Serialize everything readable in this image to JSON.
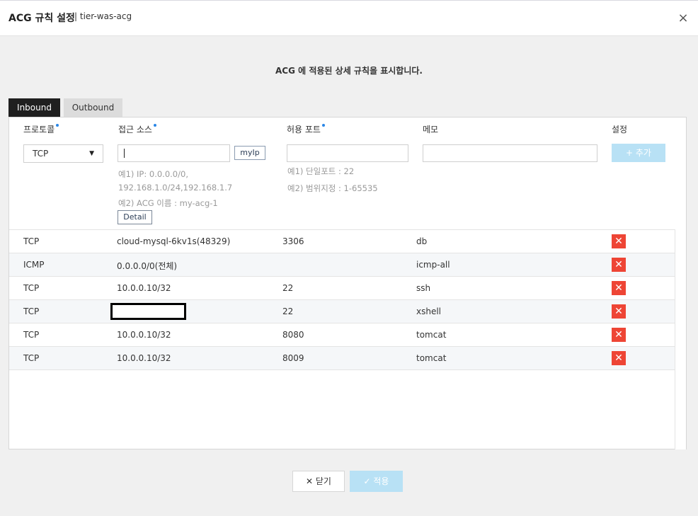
{
  "header": {
    "title": "ACG 규칙 설정",
    "subtitle": "| tier-was-acg",
    "close_icon": "×"
  },
  "description": "ACG 에 적용된 상세 규칙을 표시합니다.",
  "tabs": [
    {
      "label": "Inbound",
      "active": true
    },
    {
      "label": "Outbound",
      "active": false
    }
  ],
  "columns": {
    "protocol": "프로토콜",
    "source": "접근 소스",
    "port": "허용 포트",
    "memo": "메모",
    "settings": "설정"
  },
  "form": {
    "protocol_value": "TCP",
    "caret": "▼",
    "myip_label": "myIp",
    "add_label": "+ 추가",
    "detail_label": "Detail",
    "source_hint_1a": "예1) IP: 0.0.0.0/0,",
    "source_hint_1b": "192.168.1.0/24,192.168.1.7",
    "source_hint_2": "예2) ACG 이름 : my-acg-1",
    "port_hint_1": "예1) 단일포트 : 22",
    "port_hint_2": "예2) 범위지정 : 1-65535"
  },
  "rules": [
    {
      "protocol": "TCP",
      "source": "cloud-mysql-6kv1s(48329)",
      "port": "3306",
      "memo": "db",
      "redacted": false
    },
    {
      "protocol": "ICMP",
      "source": "0.0.0.0/0(전체)",
      "port": "",
      "memo": "icmp-all",
      "redacted": false
    },
    {
      "protocol": "TCP",
      "source": "10.0.0.10/32",
      "port": "22",
      "memo": "ssh",
      "redacted": false
    },
    {
      "protocol": "TCP",
      "source": "",
      "port": "22",
      "memo": "xshell",
      "redacted": true
    },
    {
      "protocol": "TCP",
      "source": "10.0.0.10/32",
      "port": "8080",
      "memo": "tomcat",
      "redacted": false
    },
    {
      "protocol": "TCP",
      "source": "10.0.0.10/32",
      "port": "8009",
      "memo": "tomcat",
      "redacted": false
    }
  ],
  "delete_icon": "✕",
  "footer": {
    "close_label": "✕ 닫기",
    "apply_label": "✓ 적용"
  },
  "colors": {
    "active_tab": "#1f1f1f",
    "delete": "#ee4535",
    "primary_disabled": "#b8e1f5",
    "required_dot": "#2a86e6"
  }
}
